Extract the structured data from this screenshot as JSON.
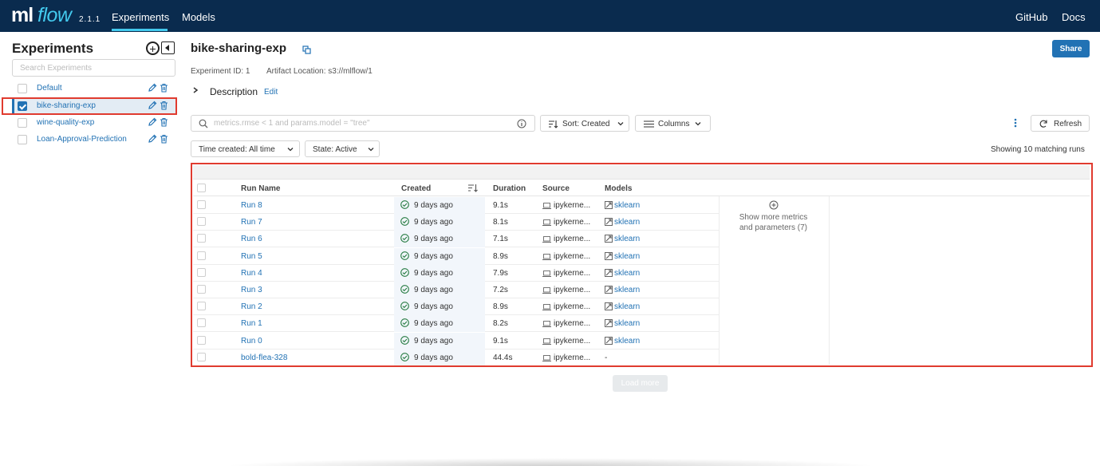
{
  "header": {
    "logo_text_ml": "ml",
    "logo_text_flow": "flow",
    "version": "2.1.1",
    "nav": [
      "Experiments",
      "Models"
    ],
    "nav_right": [
      "GitHub",
      "Docs"
    ],
    "accent_color": "#43c9ed",
    "background_color": "#0a2b4e"
  },
  "sidebar": {
    "title": "Experiments",
    "search_placeholder": "Search Experiments",
    "items": [
      {
        "name": "Default",
        "selected": false
      },
      {
        "name": "bike-sharing-exp",
        "selected": true
      },
      {
        "name": "wine-quality-exp",
        "selected": false
      },
      {
        "name": "Loan-Approval-Prediction",
        "selected": false
      }
    ]
  },
  "experiment": {
    "title": "bike-sharing-exp",
    "share_label": "Share",
    "id_text": "Experiment ID: 1",
    "artifact_text": "Artifact Location: s3://mlflow/1",
    "description_label": "Description",
    "edit_label": "Edit"
  },
  "toolbar": {
    "search_placeholder": "metrics.rmse < 1 and params.model = \"tree\"",
    "sort_label": "Sort: Created",
    "columns_label": "Columns",
    "refresh_label": "Refresh",
    "time_filter": "Time created: All time",
    "state_filter": "State: Active",
    "showing_text": "Showing 10 matching runs"
  },
  "table": {
    "headers": [
      "Run Name",
      "Created",
      "Duration",
      "Source",
      "Models"
    ],
    "rows": [
      {
        "name": "Run 8",
        "created": "9 days ago",
        "duration": "9.1s",
        "source": "ipykerne...",
        "model": "sklearn"
      },
      {
        "name": "Run 7",
        "created": "9 days ago",
        "duration": "8.1s",
        "source": "ipykerne...",
        "model": "sklearn"
      },
      {
        "name": "Run 6",
        "created": "9 days ago",
        "duration": "7.1s",
        "source": "ipykerne...",
        "model": "sklearn"
      },
      {
        "name": "Run 5",
        "created": "9 days ago",
        "duration": "8.9s",
        "source": "ipykerne...",
        "model": "sklearn"
      },
      {
        "name": "Run 4",
        "created": "9 days ago",
        "duration": "7.9s",
        "source": "ipykerne...",
        "model": "sklearn"
      },
      {
        "name": "Run 3",
        "created": "9 days ago",
        "duration": "7.2s",
        "source": "ipykerne...",
        "model": "sklearn"
      },
      {
        "name": "Run 2",
        "created": "9 days ago",
        "duration": "8.9s",
        "source": "ipykerne...",
        "model": "sklearn"
      },
      {
        "name": "Run 1",
        "created": "9 days ago",
        "duration": "8.2s",
        "source": "ipykerne...",
        "model": "sklearn"
      },
      {
        "name": "Run 0",
        "created": "9 days ago",
        "duration": "9.1s",
        "source": "ipykerne...",
        "model": "sklearn"
      },
      {
        "name": "bold-flea-328",
        "created": "9 days ago",
        "duration": "44.4s",
        "source": "ipykerne...",
        "model": "-"
      }
    ],
    "show_more_line1": "Show more metrics",
    "show_more_line2": "and parameters (7)",
    "load_more_label": "Load more"
  }
}
